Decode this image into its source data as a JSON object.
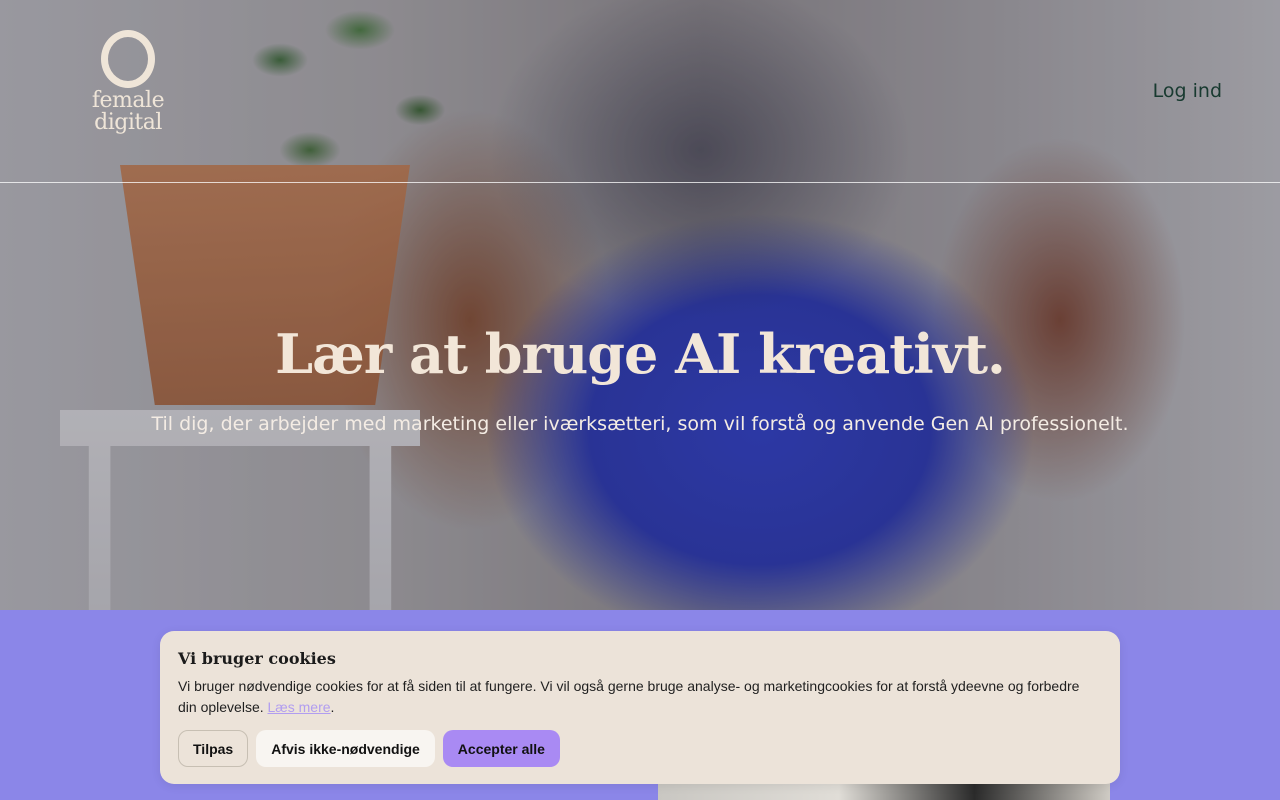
{
  "header": {
    "logo_line1": "female",
    "logo_line2": "digital",
    "login_label": "Log ind"
  },
  "hero": {
    "title": "Lær at bruge AI kreativt.",
    "subtitle": "Til dig, der arbejder med marketing eller iværksætteri, som vil forstå og anvende Gen AI professionelt."
  },
  "cookie_banner": {
    "title": "Vi bruger cookies",
    "text": "Vi bruger nødvendige cookies for at få siden til at fungere. Vi vil også gerne bruge analyse- og marketingcookies for at forstå ydeevne og forbedre din oplevelse.",
    "read_more": "Læs mere",
    "period": ".",
    "buttons": {
      "customize": "Tilpas",
      "reject": "Afvis ikke-nødvendige",
      "accept": "Accepter alle"
    }
  },
  "colors": {
    "page_background": "#8b86e8",
    "banner_background": "#ece3d9",
    "accept_button": "#a98af3",
    "link": "#b19df0",
    "logo": "#efe5d8",
    "login_text": "#183a30"
  }
}
